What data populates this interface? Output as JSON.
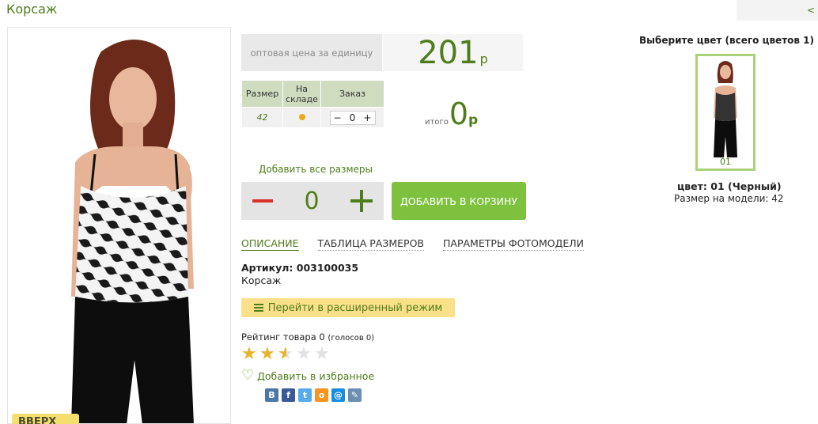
{
  "header": {
    "title": "Корсаж",
    "back_link": "<"
  },
  "gallery": {
    "up_button": "ВВЕРХ"
  },
  "price": {
    "label": "оптовая цена за единицу",
    "value": "201",
    "currency": "р"
  },
  "size_table": {
    "headers": [
      "Размер",
      "На складе",
      "Заказ"
    ],
    "rows": [
      {
        "size": "42",
        "in_stock": true,
        "qty": "0"
      }
    ],
    "minus": "−",
    "plus": "+"
  },
  "total": {
    "label": "итого",
    "value": "0",
    "currency": "р"
  },
  "add_all_sizes": "Добавить все размеры",
  "quantity": "0",
  "add_to_cart": "ДОБАВИТЬ В КОРЗИНУ",
  "tabs": [
    {
      "label": "ОПИСАНИЕ",
      "active": true
    },
    {
      "label": "ТАБЛИЦА РАЗМЕРОВ",
      "active": false
    },
    {
      "label": "ПАРАМЕТРЫ ФОТОМОДЕЛИ",
      "active": false
    }
  ],
  "product": {
    "sku": "Артикул: 003100035",
    "name": "Корсаж"
  },
  "advanced_mode": "Перейти в расширенный режим",
  "rating": {
    "label": "Рейтинг товара 0",
    "votes": "(голосов 0)",
    "stars_filled": 2.5,
    "stars_total": 5
  },
  "favorite": "Добавить в избранное",
  "social": [
    {
      "icon": "vk-icon",
      "glyph": "В",
      "color": "#4a76a8"
    },
    {
      "icon": "facebook-icon",
      "glyph": "f",
      "color": "#3b5998"
    },
    {
      "icon": "twitter-icon",
      "glyph": "t",
      "color": "#55acee"
    },
    {
      "icon": "odnoklassniki-icon",
      "glyph": "о",
      "color": "#f7931e"
    },
    {
      "icon": "mailru-icon",
      "glyph": "@",
      "color": "#168de2"
    },
    {
      "icon": "livejournal-icon",
      "glyph": "✎",
      "color": "#6a8fb3"
    }
  ],
  "colors": {
    "heading": "Выберите цвет (всего цветов 1)",
    "swatch_label": "01",
    "selected": "цвет: 01 (Черный)",
    "model_size": "Размер на модели: 42"
  },
  "accent": "#4f7d1b",
  "cart_color": "#7ec13e"
}
